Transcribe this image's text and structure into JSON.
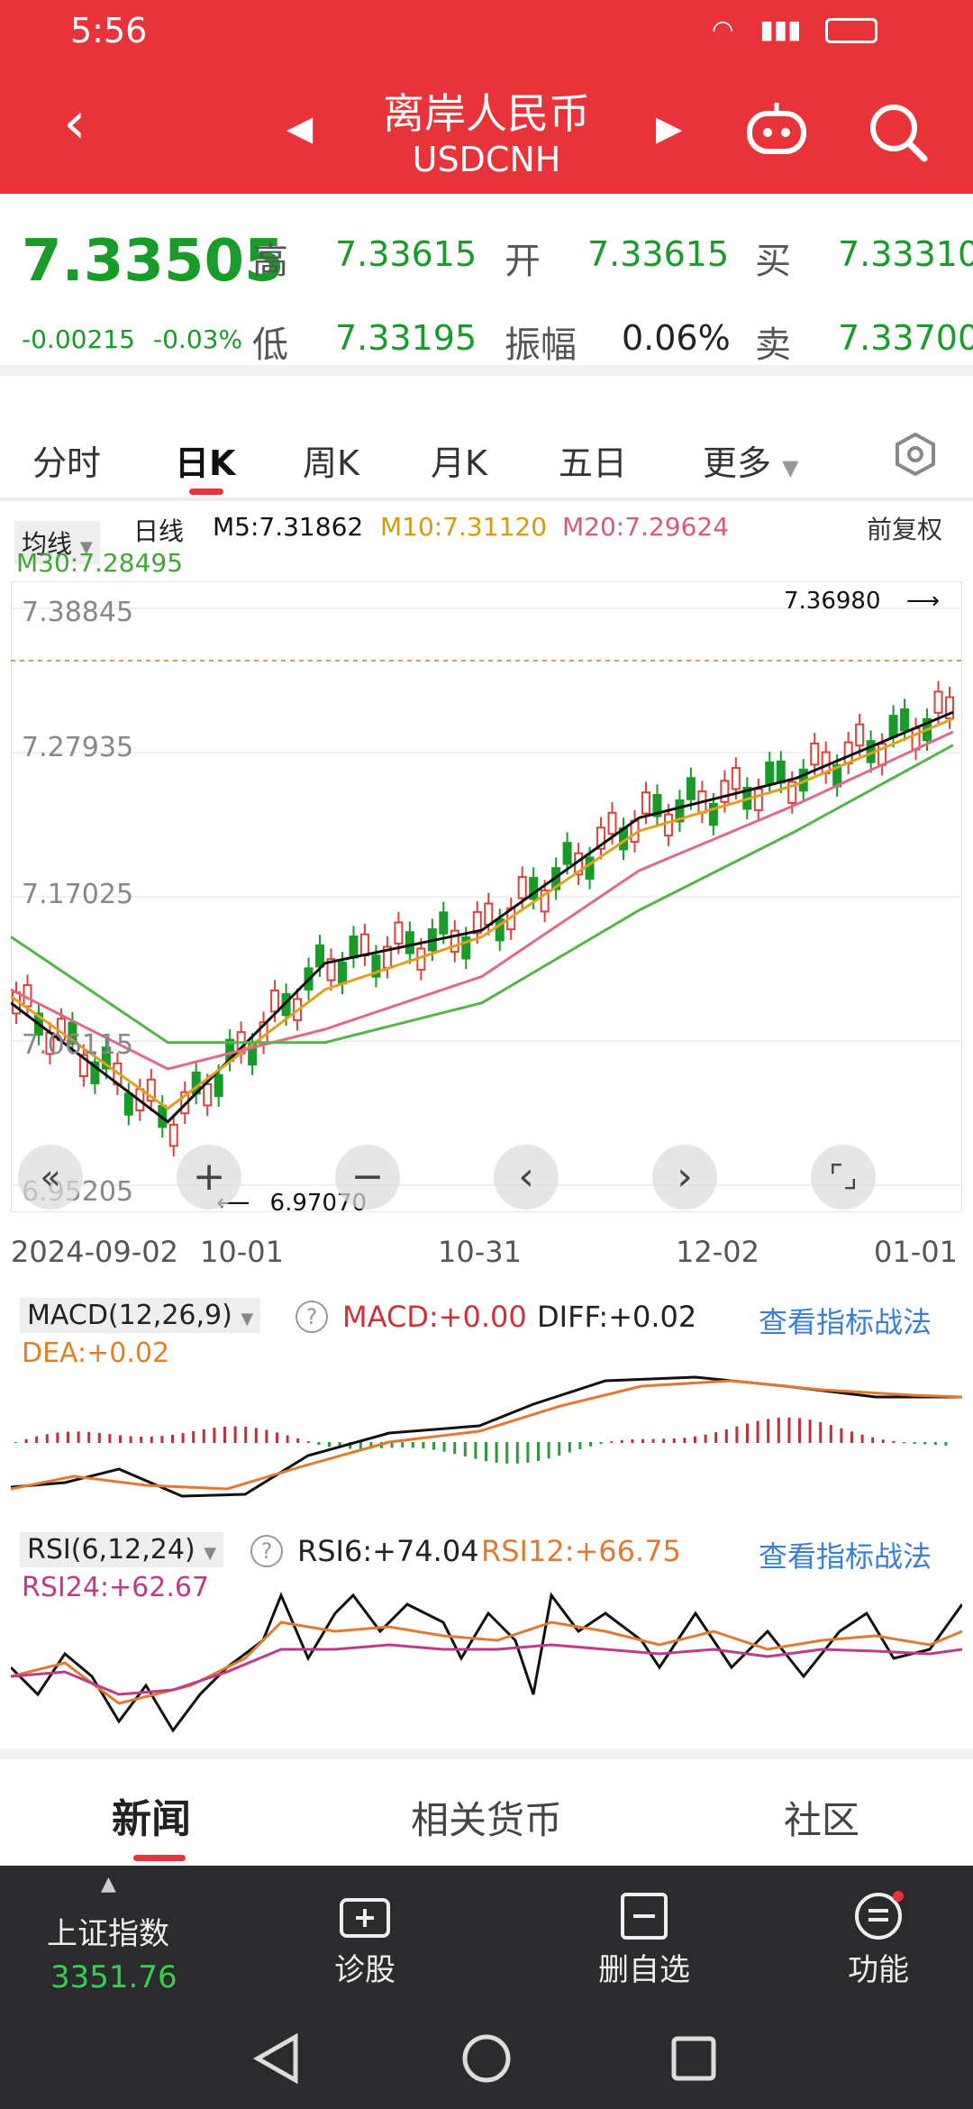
{
  "status": {
    "time": "5:56"
  },
  "header": {
    "title": "离岸人民币",
    "subtitle": "USDCNH"
  },
  "quote": {
    "last": "7.33505",
    "change": "-0.00215",
    "change_pct": "-0.03%",
    "high_label": "高",
    "high": "7.33615",
    "open_label": "开",
    "open": "7.33615",
    "buy_label": "买",
    "buy": "7.33310",
    "low_label": "低",
    "low": "7.33195",
    "amp_label": "振幅",
    "amp": "0.06%",
    "sell_label": "卖",
    "sell": "7.33700"
  },
  "tabs": [
    "分时",
    "日K",
    "周K",
    "月K",
    "五日",
    "更多"
  ],
  "ma": {
    "selector": "均线",
    "period": "日线",
    "m5": "M5:7.31862",
    "m10": "M10:7.31120",
    "m20": "M20:7.29624",
    "m30": "M30:7.28495",
    "adjust": "前复权",
    "colors": {
      "m5": "#111111",
      "m10": "#e0a020",
      "m20": "#e06a8a",
      "m30": "#55b44a"
    }
  },
  "kline": {
    "y_labels": [
      "7.38845",
      "7.27935",
      "7.17025",
      "7.06115",
      "6.95205"
    ],
    "x_labels": [
      "2024-09-02",
      "10-01",
      "10-31",
      "12-02",
      "01-01"
    ],
    "max_marker": "7.36980",
    "min_marker": "6.97070"
  },
  "chart_data": {
    "type": "line",
    "title": "USDCNH",
    "x": [
      "2024-09-02",
      "10-01",
      "10-31",
      "12-02",
      "01-01"
    ],
    "ylim": [
      6.95205,
      7.38845
    ],
    "series": [
      {
        "name": "M5",
        "values": [
          7.09,
          7.0,
          7.12,
          7.145,
          7.23,
          7.26,
          7.31
        ]
      },
      {
        "name": "M10",
        "values": [
          7.095,
          7.01,
          7.1,
          7.14,
          7.22,
          7.255,
          7.305
        ]
      },
      {
        "name": "M20",
        "values": [
          7.1,
          7.04,
          7.07,
          7.11,
          7.19,
          7.24,
          7.295
        ]
      },
      {
        "name": "M30",
        "values": [
          7.14,
          7.06,
          7.06,
          7.09,
          7.16,
          7.22,
          7.285
        ]
      }
    ]
  },
  "macd": {
    "label": "MACD(12,26,9)",
    "macd": "MACD:+0.00",
    "diff": "DIFF:+0.02",
    "dea": "DEA:+0.02",
    "link": "查看指标战法"
  },
  "rsi": {
    "label": "RSI(6,12,24)",
    "rsi6": "RSI6:+74.04",
    "rsi12": "RSI12:+66.75",
    "rsi24": "RSI24:+62.67",
    "link": "查看指标战法"
  },
  "bottom_tabs": [
    "新闻",
    "相关货币",
    "社区"
  ],
  "navbar": {
    "index_name": "上证指数",
    "index_value": "3351.76",
    "items": [
      "诊股",
      "删自选",
      "功能"
    ]
  }
}
